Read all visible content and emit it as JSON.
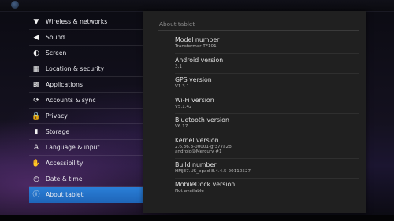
{
  "sidebar": {
    "items": [
      {
        "label": "Wireless & networks",
        "icon": "wireless-icon",
        "glyph": "▼"
      },
      {
        "label": "Sound",
        "icon": "speaker-icon",
        "glyph": "◀"
      },
      {
        "label": "Screen",
        "icon": "brightness-icon",
        "glyph": "◐"
      },
      {
        "label": "Location & security",
        "icon": "grid-lock-icon",
        "glyph": "▦"
      },
      {
        "label": "Applications",
        "icon": "apps-icon",
        "glyph": "▩"
      },
      {
        "label": "Accounts & sync",
        "icon": "sync-icon",
        "glyph": "⟳"
      },
      {
        "label": "Privacy",
        "icon": "lock-icon",
        "glyph": "🔒"
      },
      {
        "label": "Storage",
        "icon": "storage-icon",
        "glyph": "▮"
      },
      {
        "label": "Language & input",
        "icon": "language-icon",
        "glyph": "A"
      },
      {
        "label": "Accessibility",
        "icon": "accessibility-icon",
        "glyph": "✋"
      },
      {
        "label": "Date & time",
        "icon": "clock-icon",
        "glyph": "◷"
      },
      {
        "label": "About tablet",
        "icon": "info-icon",
        "glyph": "ⓘ"
      }
    ],
    "selected_index": 11
  },
  "panel": {
    "title": "About tablet",
    "entries": [
      {
        "title": "Model number",
        "value": "Transformer TF101"
      },
      {
        "title": "Android version",
        "value": "3.1"
      },
      {
        "title": "GPS version",
        "value": "V1.3.1"
      },
      {
        "title": "Wi-Fi version",
        "value": "V5.1.42"
      },
      {
        "title": "Bluetooth version",
        "value": "V6.17"
      },
      {
        "title": "Kernel version",
        "value": "2.6.36.3-00001-gf377a2b",
        "value2": "android@Mercury #1"
      },
      {
        "title": "Build number",
        "value": "HMJ37.US_epad-8.4.4.5-20110527"
      },
      {
        "title": "MobileDock version",
        "value": "Not available"
      }
    ]
  },
  "colors": {
    "selected": "#2373c9",
    "panel": "#202020"
  }
}
